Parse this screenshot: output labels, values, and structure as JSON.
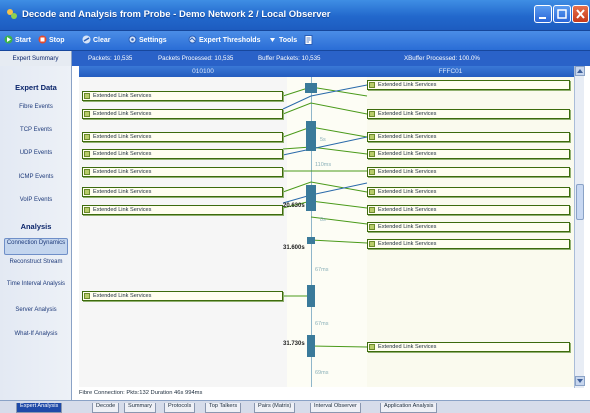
{
  "window": {
    "title": "Decode and Analysis from Probe - Demo Network 2 / Local Observer"
  },
  "toolbar": {
    "start": "Start",
    "stop": "Stop",
    "clear": "Clear",
    "settings": "Settings",
    "expert_thresholds": "Expert Thresholds",
    "tools": "Tools"
  },
  "infobar": {
    "summary_button": "Expert Summary",
    "packets": "Packets: 10,535",
    "packets_processed": "Packets Processed: 10,535",
    "buffer_packets": "Buffer Packets: 10,535",
    "xbuffer": "XBuffer Processed: 100.0%"
  },
  "left_panel": {
    "expert_heading": "Expert Data",
    "expert_items": [
      "Fibre Events",
      "TCP Events",
      "UDP Events",
      "ICMP Events",
      "VoIP Events"
    ],
    "analysis_heading": "Analysis",
    "analysis_items": [
      "Connection Dynamics",
      "Reconstruct Stream",
      "Time Interval Analysis",
      "Server Analysis",
      "What-If Analysis"
    ],
    "selected_item": "Connection Dynamics"
  },
  "graph": {
    "left_header": "010100",
    "right_header": "FFFC01",
    "box_label": "Extended Link Services",
    "left_boxes_count": 8,
    "right_boxes_count": 10,
    "time_labels": {
      "t1": "5s",
      "t2": "110ms",
      "t3": "20.630s",
      "t4": "8s",
      "t5": "31.600s",
      "t6": "67ms",
      "t7": "67ms",
      "t8": "31.730s",
      "t9": "69ms"
    }
  },
  "status": {
    "text": "Fibre Connection:  Pkts:132  Duration 46s 994ms"
  },
  "tabs": [
    "Expert Analysis",
    "Decode",
    "Summary",
    "Protocols",
    "Top Talkers",
    "Pairs (Matrix)",
    "Interval Observer",
    "Application Analysis"
  ],
  "active_tab": "Expert Analysis",
  "colors": {
    "titlebar": "#2268cc",
    "box_border": "#3d6b0d",
    "box_fill": "#fffef0",
    "link_green": "#4a9a1a",
    "link_blue": "#2a6aaa"
  }
}
